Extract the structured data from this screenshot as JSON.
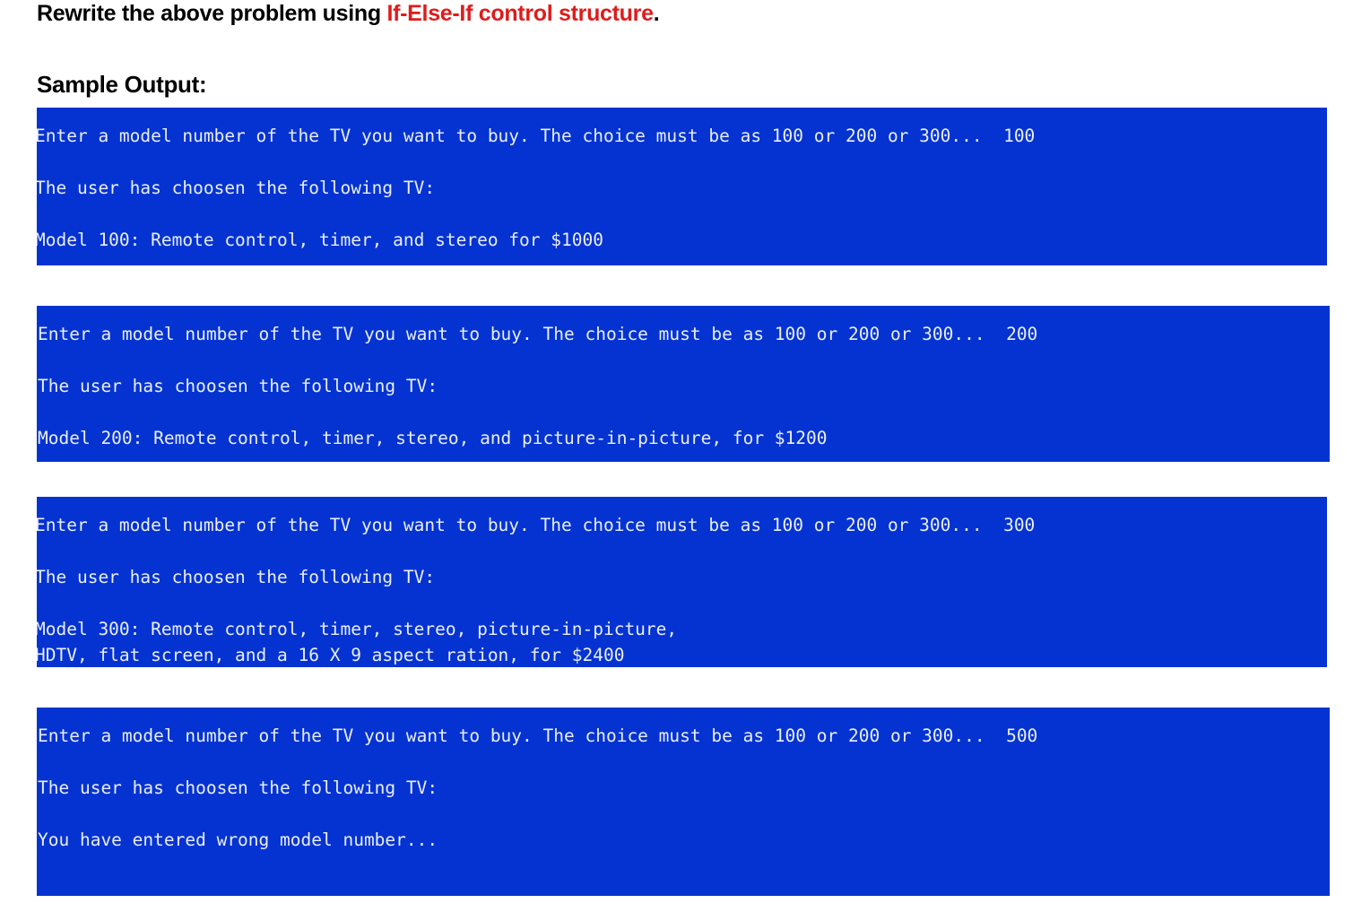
{
  "document": {
    "intro": {
      "prefix": "Rewrite the above problem using ",
      "accent": "If-Else-If control structure",
      "suffix": "."
    },
    "sample_output_heading": "Sample Output:",
    "accent_color": "#e01b1b",
    "console_background": "#0433d1",
    "console_text_color": "#e9eefc"
  },
  "console_blocks": [
    {
      "id": "block-100",
      "input_value": "100",
      "lines": [
        "Enter a model number of the TV you want to buy. The choice must be as 100 or 200 or 300...  100",
        "",
        "The user has choosen the following TV:",
        "",
        "Model 100: Remote control, timer, and stereo for $1000"
      ]
    },
    {
      "id": "block-200",
      "input_value": "200",
      "lines": [
        "Enter a model number of the TV you want to buy. The choice must be as 100 or 200 or 300...  200",
        "",
        "The user has choosen the following TV:",
        "",
        "Model 200: Remote control, timer, stereo, and picture-in-picture, for $1200"
      ]
    },
    {
      "id": "block-300",
      "input_value": "300",
      "lines": [
        "Enter a model number of the TV you want to buy. The choice must be as 100 or 200 or 300...  300",
        "",
        "The user has choosen the following TV:",
        "",
        "Model 300: Remote control, timer, stereo, picture-in-picture,",
        "HDTV, flat screen, and a 16 X 9 aspect ration, for $2400"
      ]
    },
    {
      "id": "block-500",
      "input_value": "500",
      "lines": [
        "Enter a model number of the TV you want to buy. The choice must be as 100 or 200 or 300...  500",
        "",
        "The user has choosen the following TV:",
        "",
        "You have entered wrong model number..."
      ]
    }
  ]
}
